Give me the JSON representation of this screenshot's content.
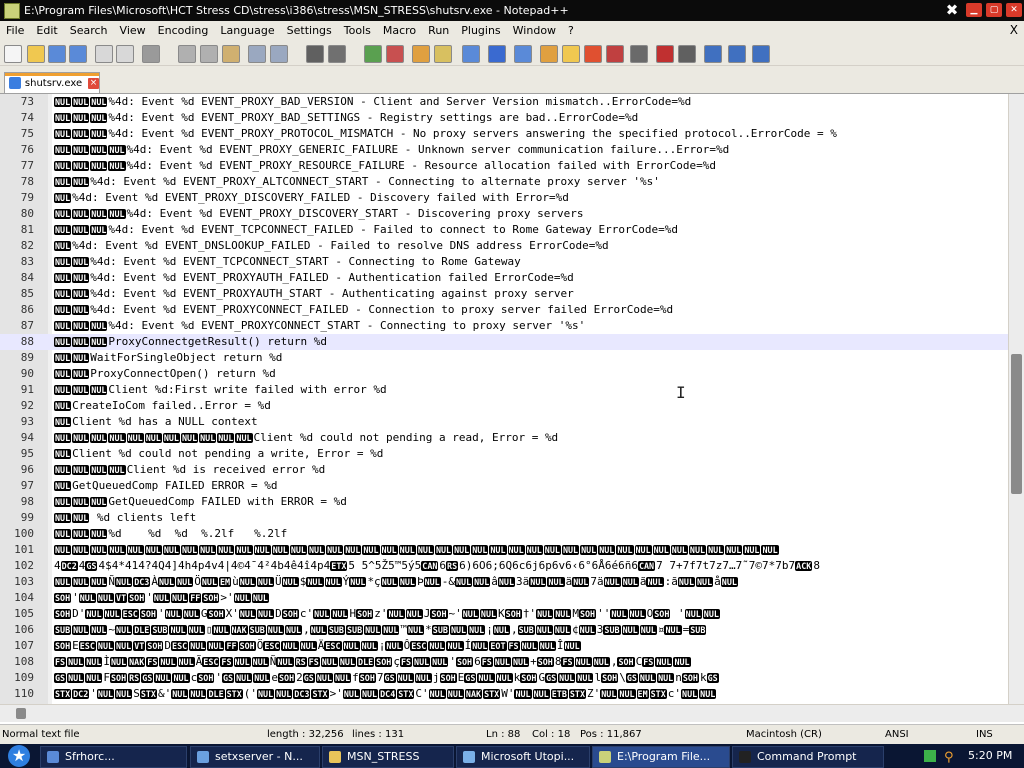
{
  "window": {
    "title": "E:\\Program Files\\Microsoft\\HCT Stress CD\\stress\\i386\\stress\\MSN_STRESS\\shutsrv.exe - Notepad++"
  },
  "menu": [
    "File",
    "Edit",
    "Search",
    "View",
    "Encoding",
    "Language",
    "Settings",
    "Tools",
    "Macro",
    "Run",
    "Plugins",
    "Window",
    "?"
  ],
  "menu_close": "X",
  "toolbar_icons": [
    "new-icon",
    "open-icon",
    "save-icon",
    "save-all-icon",
    "close-icon",
    "close-all-icon",
    "print-icon",
    "cut-icon",
    "copy-icon",
    "paste-icon",
    "undo-icon",
    "redo-icon",
    "find-icon",
    "replace-icon",
    "zoom-in-icon",
    "zoom-out-icon",
    "sync-v-icon",
    "sync-h-icon",
    "wrap-icon",
    "all-chars-icon",
    "indent-guide-icon",
    "udl-icon",
    "doc-map-icon",
    "function-list-icon",
    "folder-workspace-icon",
    "monitor-icon",
    "record-macro-icon",
    "stop-macro-icon",
    "play-macro-icon",
    "play-multiple-icon",
    "save-macro-icon"
  ],
  "tab": {
    "label": "shutsrv.exe"
  },
  "editor": {
    "current_line": 88,
    "lines": [
      {
        "n": "73",
        "t": "{NUL}{NUL}{NUL}%4d: Event %d EVENT_PROXY_BAD_VERSION - Client and Server Version mismatch..ErrorCode=%d"
      },
      {
        "n": "74",
        "t": "{NUL}{NUL}{NUL}%4d: Event %d EVENT_PROXY_BAD_SETTINGS - Registry settings are bad..ErrorCode=%d"
      },
      {
        "n": "75",
        "t": "{NUL}{NUL}{NUL}%4d: Event %d EVENT_PROXY_PROTOCOL_MISMATCH - No proxy servers answering the specified protocol..ErrorCode = %"
      },
      {
        "n": "76",
        "t": "{NUL}{NUL}{NUL}{NUL}%4d: Event %d EVENT_PROXY_GENERIC_FAILURE - Unknown server communication failure...Error=%d"
      },
      {
        "n": "77",
        "t": "{NUL}{NUL}{NUL}{NUL}%4d: Event %d EVENT_PROXY_RESOURCE_FAILURE - Resource allocation failed with ErrorCode=%d"
      },
      {
        "n": "78",
        "t": "{NUL}{NUL}%4d: Event %d EVENT_PROXY_ALTCONNECT_START - Connecting to alternate proxy server '%s'"
      },
      {
        "n": "79",
        "t": "{NUL}%4d: Event %d EVENT_PROXY_DISCOVERY_FAILED - Discovery failed with Error=%d"
      },
      {
        "n": "80",
        "t": "{NUL}{NUL}{NUL}{NUL}%4d: Event %d EVENT_PROXY_DISCOVERY_START - Discovering proxy servers"
      },
      {
        "n": "81",
        "t": "{NUL}{NUL}{NUL}%4d: Event %d EVENT_TCPCONNECT_FAILED - Failed to connect to Rome Gateway ErrorCode=%d"
      },
      {
        "n": "82",
        "t": "{NUL}%4d: Event %d EVENT_DNSLOOKUP_FAILED - Failed to resolve DNS address ErrorCode=%d"
      },
      {
        "n": "83",
        "t": "{NUL}{NUL}%4d: Event %d EVENT_TCPCONNECT_START - Connecting to Rome Gateway"
      },
      {
        "n": "84",
        "t": "{NUL}{NUL}%4d: Event %d EVENT_PROXYAUTH_FAILED - Authentication failed ErrorCode=%d"
      },
      {
        "n": "85",
        "t": "{NUL}{NUL}%4d: Event %d EVENT_PROXYAUTH_START - Authenticating against proxy server"
      },
      {
        "n": "86",
        "t": "{NUL}{NUL}%4d: Event %d EVENT_PROXYCONNECT_FAILED - Connection to proxy server failed ErrorCode=%d"
      },
      {
        "n": "87",
        "t": "{NUL}{NUL}{NUL}%4d: Event %d EVENT_PROXYCONNECT_START - Connecting to proxy server '%s'"
      },
      {
        "n": "88",
        "t": "{NUL}{NUL}{NUL}ProxyConnectgetResult() return %d"
      },
      {
        "n": "89",
        "t": "{NUL}{NUL}WaitForSingleObject return %d"
      },
      {
        "n": "90",
        "t": "{NUL}{NUL}ProxyConnectOpen() return %d"
      },
      {
        "n": "91",
        "t": "{NUL}{NUL}{NUL}Client %d:First write failed with error %d"
      },
      {
        "n": "92",
        "t": "{NUL}CreateIoCom failed..Error = %d"
      },
      {
        "n": "93",
        "t": "{NUL}Client %d has a NULL context"
      },
      {
        "n": "94",
        "t": "{NUL}{NUL}{NUL}{NUL}{NUL}{NUL}{NUL}{NUL}{NUL}{NUL}{NUL}Client %d could not pending a read, Error = %d"
      },
      {
        "n": "95",
        "t": "{NUL}Client %d could not pending a write, Error = %d"
      },
      {
        "n": "96",
        "t": "{NUL}{NUL}{NUL}{NUL}Client %d is received error %d"
      },
      {
        "n": "97",
        "t": "{NUL}GetQueuedComp FAILED ERROR = %d"
      },
      {
        "n": "98",
        "t": "{NUL}{NUL}{NUL}GetQueuedComp FAILED with ERROR = %d"
      },
      {
        "n": "99",
        "t": "{NUL}{NUL} %d clients left"
      },
      {
        "n": "100",
        "t": "{NUL}{NUL}{NUL}%d    %d  %d  %.2lf   %.2lf"
      },
      {
        "n": "101",
        "t": "{NUL}{NUL}{NUL}{NUL}{NUL}{NUL}{NUL}{NUL}{NUL}{NUL}{NUL}{NUL}{NUL}{NUL}{NUL}{NUL}{NUL}{NUL}{NUL}{NUL}{NUL}{NUL}{NUL}{NUL}{NUL}{NUL}{NUL}{NUL}{NUL}{NUL}{NUL}{NUL}{NUL}{NUL}{NUL}{NUL}{NUL}{NUL}{NUL}{NUL}"
      },
      {
        "n": "102",
        "t": "4{DC2}4{GS}4$4*414?4Q4]4h4p4v4|4©4¯4²4b4ê4î4p4{ETX}5 5^5Ž5™5ý5{CAN}6{RS}6)6O6;6Q6c6j6p6v6‹6°6Å6é6ñ6{CAN}7 7+7f7t7z7…7˜7©7*7b7{ACK}8"
      },
      {
        "n": "103",
        "t": "{NUL}{NUL}{NUL}Ñ{NUL}{DC3}À{NUL}{NUL}Ö{NUL}{EM}ù{NUL}{NUL}Ü{NUL}${NUL}{NUL}Ý{NUL}*ç{NUL}{NUL}Þ{NUL}-&{NUL}{NUL}â{NUL}3ä{NUL}{NUL}ä{NUL}7ä{NUL}{NUL}ã{NUL}:ã{NUL}{NUL}å{NUL}"
      },
      {
        "n": "104",
        "t": "{SOH}'{NUL}{NUL}{VT}{SOH}'{NUL}{NUL}{FF}{SOH}>'{NUL}{NUL}"
      },
      {
        "n": "105",
        "t": "{SOH}D'{NUL}{NUL}{ESC}{SOH}'{NUL}{NUL}G{SOH}X'{NUL}{NUL}D{SOH}c'{NUL}{NUL}H{SOH}z'{NUL}{NUL}J{SOH}~'{NUL}{NUL}K{SOH}†'{NUL}{NUL}M{SOH}''{NUL}{NUL}O{SOH} '{NUL}{NUL}"
      },
      {
        "n": "106",
        "t": "{SUB}{NUL}{NUL}~{NUL}{DLE}{SUB}{NUL}{NUL}▯{NUL}{NAK}{SUB}{NUL}{NUL},{NUL}{SUB}{SUB}{NUL}{NUL}™{NUL}*{SUB}{NUL}{NUL}¡{NUL},{SUB}{NUL}{NUL}¢{NUL}3{SUB}{NUL}{NUL}¤{NUL}={SUB}"
      },
      {
        "n": "107",
        "t": "{SOH}E{ESC}{NUL}{NUL}{VT}{SOH}D{ESC}{NUL}{NUL}{FF}{SOH}Ö{ESC}{NUL}{NUL}Ä{ESC}{NUL}{NUL}¡{NUL}Ô{ESC}{NUL}{NUL}Í{NUL}{EOT}{FS}{NUL}{NUL}Î{NUL}"
      },
      {
        "n": "108",
        "t": "{FS}{NUL}{NUL}Ì{NUL}{NAK}{FS}{NUL}{NUL}Ã{ESC}{FS}{NUL}{NUL}Ñ{NUL}{RS}{FS}{NUL}{NUL}{DLE}{SOH}ç{FS}{NUL}{NUL}'{SOH}6{FS}{NUL}{NUL}+{SOH}8{FS}{NUL}{NUL},{SOH}C{FS}{NUL}{NUL}"
      },
      {
        "n": "109",
        "t": "{GS}{NUL}{NUL}F{SOH}{RS}{GS}{NUL}{NUL}c{SOH}'{GS}{NUL}{NUL}e{SOH}2{GS}{NUL}{NUL}f{SOH}7{GS}{NUL}{NUL}j{SOH}E{GS}{NUL}{NUL}k{SOH}G{GS}{NUL}{NUL}l{SOH}\\{GS}{NUL}{NUL}n{SOH}k{GS}"
      },
      {
        "n": "110",
        "t": "{STX}{DC2}'{NUL}{NUL}S{STX}&'{NUL}{NUL}{DLE}{STX}('{NUL}{NUL}{DC3}{STX}>'{NUL}{NUL}{DC4}{STX}C'{NUL}{NUL}{NAK}{STX}W'{NUL}{NUL}{ETB}{STX}Z'{NUL}{NUL}{EM}{STX}c'{NUL}{NUL}"
      }
    ]
  },
  "status": {
    "type": "Normal text file",
    "length": "length : 32,256",
    "lines": "lines : 131",
    "ln": "Ln : 88",
    "col": "Col : 18",
    "pos": "Pos : 11,867",
    "eol": "Macintosh (CR)",
    "encoding": "ANSI",
    "mode": "INS"
  },
  "taskbar": {
    "tasks": [
      {
        "label": "Sfrhorc...",
        "icon_color": "#5a8ad8"
      },
      {
        "label": "setxserver - N...",
        "icon_color": "#6aa0e0"
      },
      {
        "label": "MSN_STRESS",
        "icon_color": "#e8c45a"
      },
      {
        "label": "Microsoft Utopi...",
        "icon_color": "#7ab0e8"
      },
      {
        "label": "E:\\Program File...",
        "icon_color": "#c9d27a",
        "active": true
      },
      {
        "label": "Command Prompt",
        "icon_color": "#222222"
      }
    ],
    "clock": "5:20 PM"
  }
}
